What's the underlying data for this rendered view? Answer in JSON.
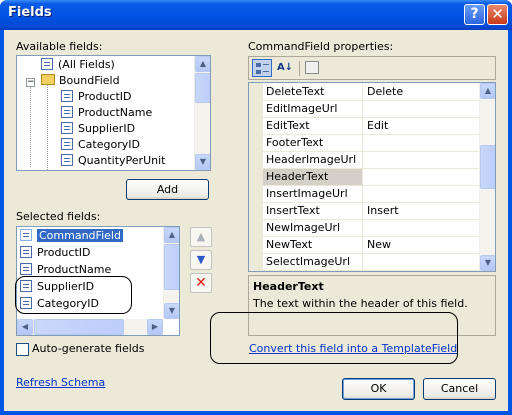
{
  "window": {
    "title": "Fields",
    "help_label": "?",
    "close_label": "✕"
  },
  "available": {
    "label": "Available fields:",
    "items": [
      {
        "label": "(All Fields)",
        "icon": "all-fields-icon"
      },
      {
        "label": "BoundField",
        "icon": "folder-icon"
      },
      {
        "label": "ProductID",
        "icon": "field-icon"
      },
      {
        "label": "ProductName",
        "icon": "field-icon"
      },
      {
        "label": "SupplierID",
        "icon": "field-icon"
      },
      {
        "label": "CategoryID",
        "icon": "field-icon"
      },
      {
        "label": "QuantityPerUnit",
        "icon": "field-icon"
      }
    ],
    "expander": "−"
  },
  "add_button": "Add",
  "selected": {
    "label": "Selected fields:",
    "items": [
      {
        "label": "CommandField",
        "selected": true
      },
      {
        "label": "ProductID",
        "selected": false
      },
      {
        "label": "ProductName",
        "selected": false
      },
      {
        "label": "SupplierID",
        "selected": false
      },
      {
        "label": "CategoryID",
        "selected": false
      }
    ]
  },
  "move_buttons": {
    "up": "▲",
    "down": "▼",
    "delete": "✕"
  },
  "autogen_label": "Auto-generate fields",
  "refresh_link": "Refresh Schema",
  "properties": {
    "label": "CommandField properties:",
    "toolbar": {
      "categorized": "categorized-icon",
      "alphabetical": "alphabetical-icon",
      "pages": "property-pages-icon"
    },
    "rows": [
      {
        "name": "DeleteText",
        "value": "Delete"
      },
      {
        "name": "EditImageUrl",
        "value": ""
      },
      {
        "name": "EditText",
        "value": "Edit"
      },
      {
        "name": "FooterText",
        "value": ""
      },
      {
        "name": "HeaderImageUrl",
        "value": ""
      },
      {
        "name": "HeaderText",
        "value": "",
        "selected": true
      },
      {
        "name": "InsertImageUrl",
        "value": ""
      },
      {
        "name": "InsertText",
        "value": "Insert"
      },
      {
        "name": "NewImageUrl",
        "value": ""
      },
      {
        "name": "NewText",
        "value": "New"
      },
      {
        "name": "SelectImageUrl",
        "value": ""
      }
    ]
  },
  "description": {
    "title": "HeaderText",
    "text": "The text within the header of this field."
  },
  "convert_link": "Convert this field into a TemplateField",
  "ok_button": "OK",
  "cancel_button": "Cancel"
}
